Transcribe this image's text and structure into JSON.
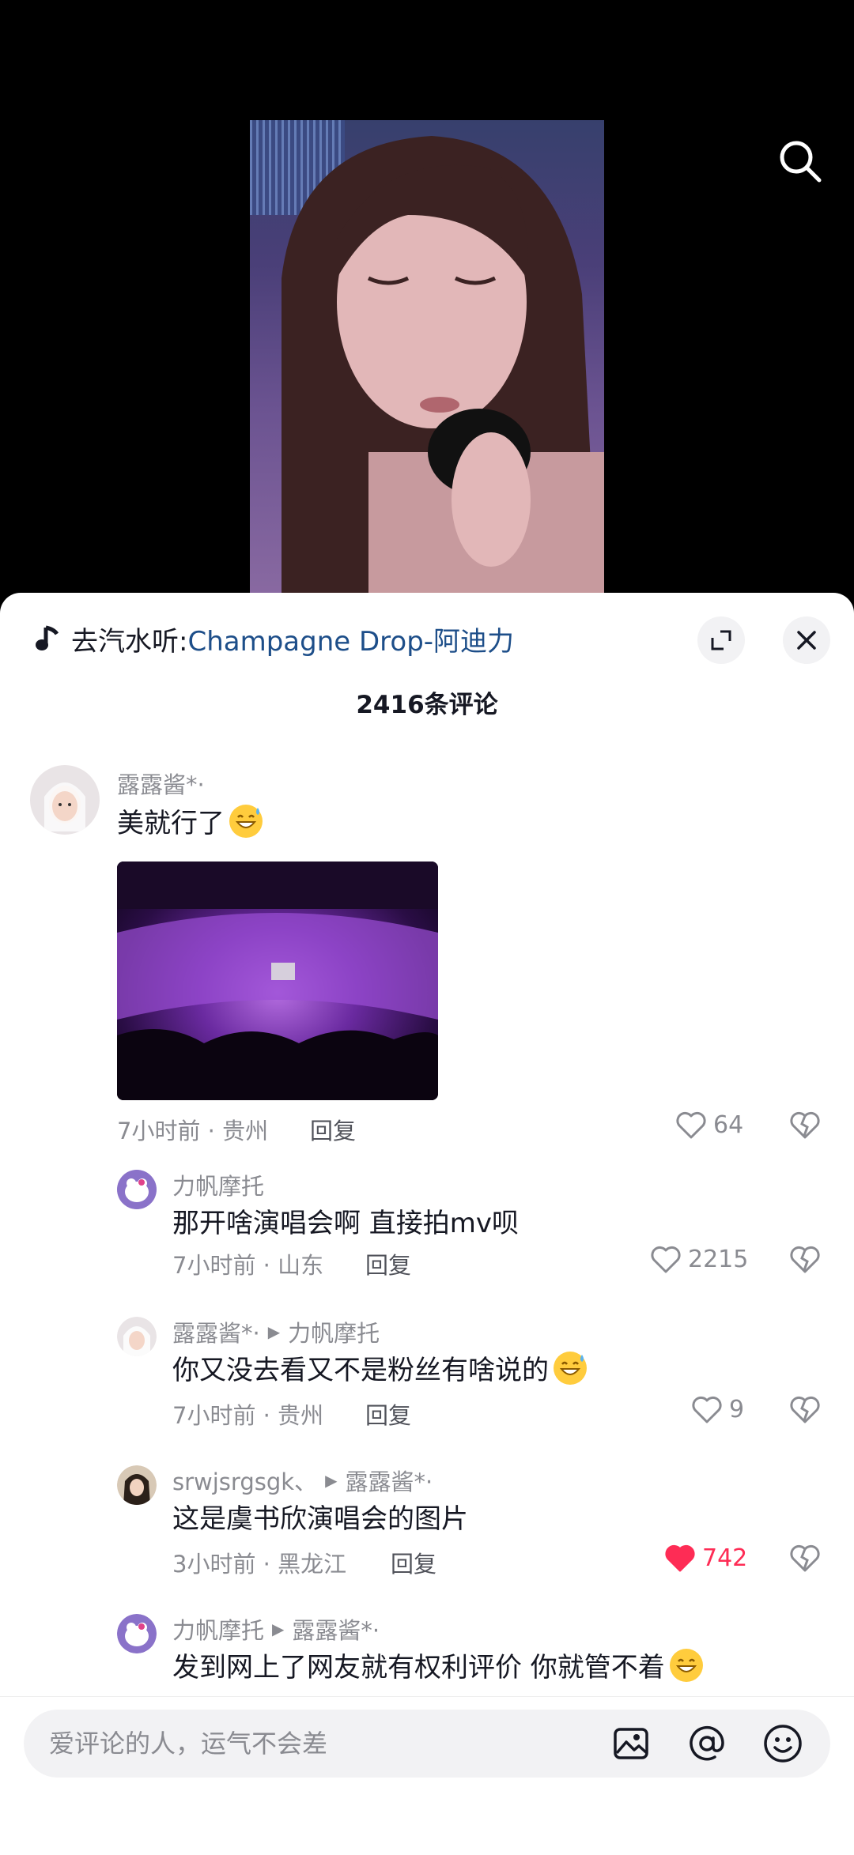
{
  "music": {
    "prefix": "去汽水听:",
    "title": "Champagne Drop-阿迪力"
  },
  "comment_count": "2416条评论",
  "comments": [
    {
      "user": "露露酱*·",
      "text": "美就行了",
      "time": "7小时前 · 贵州",
      "reply": "回复",
      "likes": "64"
    },
    {
      "user": "力帆摩托",
      "text": "那开啥演唱会啊 直接拍mv呗",
      "time": "7小时前 · 山东",
      "reply": "回复",
      "likes": "2215"
    },
    {
      "user": "露露酱*·",
      "reply_to": "力帆摩托",
      "text": "你又没去看又不是粉丝有啥说的",
      "time": "7小时前 · 贵州",
      "reply": "回复",
      "likes": "9"
    },
    {
      "user": "srwjsrgsgk、",
      "reply_to": "露露酱*·",
      "text": "这是虞书欣演唱会的图片",
      "time": "3小时前 · 黑龙江",
      "reply": "回复",
      "likes": "742",
      "liked": true
    },
    {
      "user": "力帆摩托",
      "reply_to": "露露酱*·",
      "text": "发到网上了网友就有权利评价 你就管不着"
    }
  ],
  "input": {
    "placeholder": "爱评论的人，运气不会差"
  },
  "colors": {
    "accent_like": "#fe2c55",
    "music_link": "#1d4e89"
  },
  "icons": [
    "search-icon",
    "music-note-icon",
    "expand-icon",
    "close-icon",
    "heart-icon",
    "broken-heart-icon",
    "image-icon",
    "at-icon",
    "smiley-icon"
  ]
}
